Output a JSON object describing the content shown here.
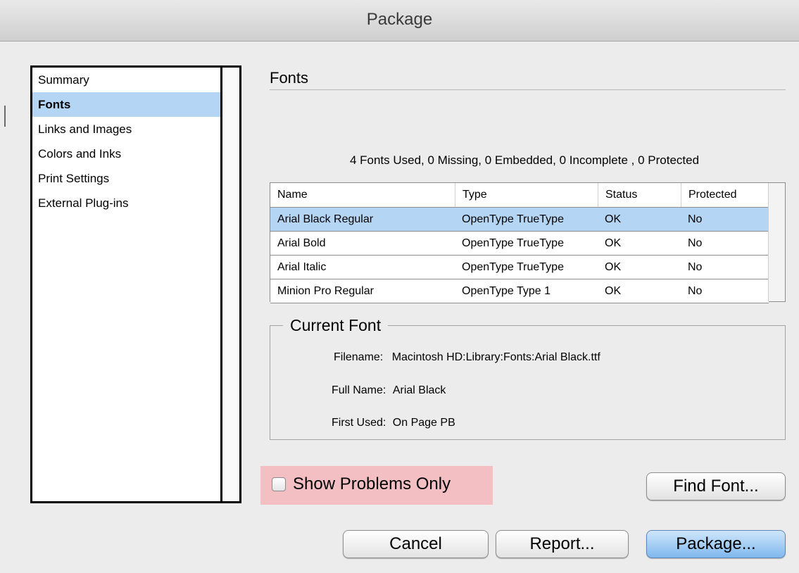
{
  "window": {
    "title": "Package"
  },
  "sidebar": {
    "items": [
      {
        "label": "Summary",
        "selected": false
      },
      {
        "label": "Fonts",
        "selected": true
      },
      {
        "label": "Links and Images",
        "selected": false
      },
      {
        "label": "Colors and Inks",
        "selected": false
      },
      {
        "label": "Print Settings",
        "selected": false
      },
      {
        "label": "External Plug-ins",
        "selected": false
      }
    ]
  },
  "main": {
    "section_title": "Fonts",
    "summary": "4 Fonts Used, 0 Missing, 0 Embedded, 0 Incomplete , 0 Protected",
    "table": {
      "columns": [
        "Name",
        "Type",
        "Status",
        "Protected"
      ],
      "rows": [
        {
          "name": "Arial Black Regular",
          "type": "OpenType TrueType",
          "status": "OK",
          "protected": "No",
          "selected": true
        },
        {
          "name": "Arial Bold",
          "type": "OpenType TrueType",
          "status": "OK",
          "protected": "No",
          "selected": false
        },
        {
          "name": "Arial Italic",
          "type": "OpenType TrueType",
          "status": "OK",
          "protected": "No",
          "selected": false
        },
        {
          "name": "Minion Pro Regular",
          "type": "OpenType Type 1",
          "status": "OK",
          "protected": "No",
          "selected": false
        }
      ]
    },
    "current_font": {
      "legend": "Current Font",
      "filename_label": "Filename:",
      "filename_value": "Macintosh HD:Library:Fonts:Arial Black.ttf",
      "fullname_label": "Full Name:",
      "fullname_value": "Arial Black",
      "firstused_label": "First Used:",
      "firstused_value": "On Page PB"
    },
    "show_problems": {
      "label": "Show Problems Only",
      "checked": false
    },
    "buttons": {
      "find_font": "Find Font...",
      "cancel": "Cancel",
      "report": "Report...",
      "package": "Package..."
    }
  },
  "colors": {
    "selection": "#b5d5f5",
    "highlight_box": "#f3bfc3",
    "primary_button": "#7fb8ee"
  }
}
